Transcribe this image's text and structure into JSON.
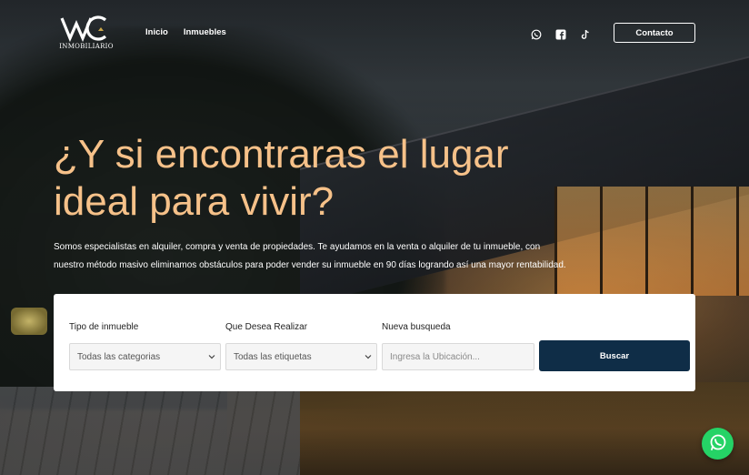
{
  "brand": {
    "logo_icon": "wc-monogram-logo",
    "logo_text": "INMOBILIARIO"
  },
  "nav": {
    "items": [
      {
        "label": "Inicio"
      },
      {
        "label": "Inmuebles"
      }
    ]
  },
  "socials": {
    "icons": [
      "whatsapp-icon",
      "facebook-icon",
      "tiktok-icon"
    ]
  },
  "header": {
    "contact_label": "Contacto"
  },
  "hero": {
    "headline_line1": "¿Y si encontraras el lugar",
    "headline_line2": "ideal para vivir?",
    "subtitle_line1": "Somos especialistas en alquiler, compra y venta de propiedades. Te ayudamos en la venta o alquiler de tu inmueble, con",
    "subtitle_line2": "nuestro método masivo eliminamos obstáculos para poder vender su inmueble en 90 días logrando así una mayor rentabilidad.",
    "headline_color": "#f6c189"
  },
  "search": {
    "type_label": "Tipo de inmueble",
    "type_value": "Todas las categorias",
    "action_label": "Que Desea Realizar",
    "action_value": "Todas las etiquetas",
    "location_label": "Nueva busqueda",
    "location_placeholder": "Ingresa la Ubicación...",
    "button_label": "Buscar",
    "button_color": "#0f2d47"
  },
  "floating": {
    "whatsapp_color": "#25d366"
  }
}
